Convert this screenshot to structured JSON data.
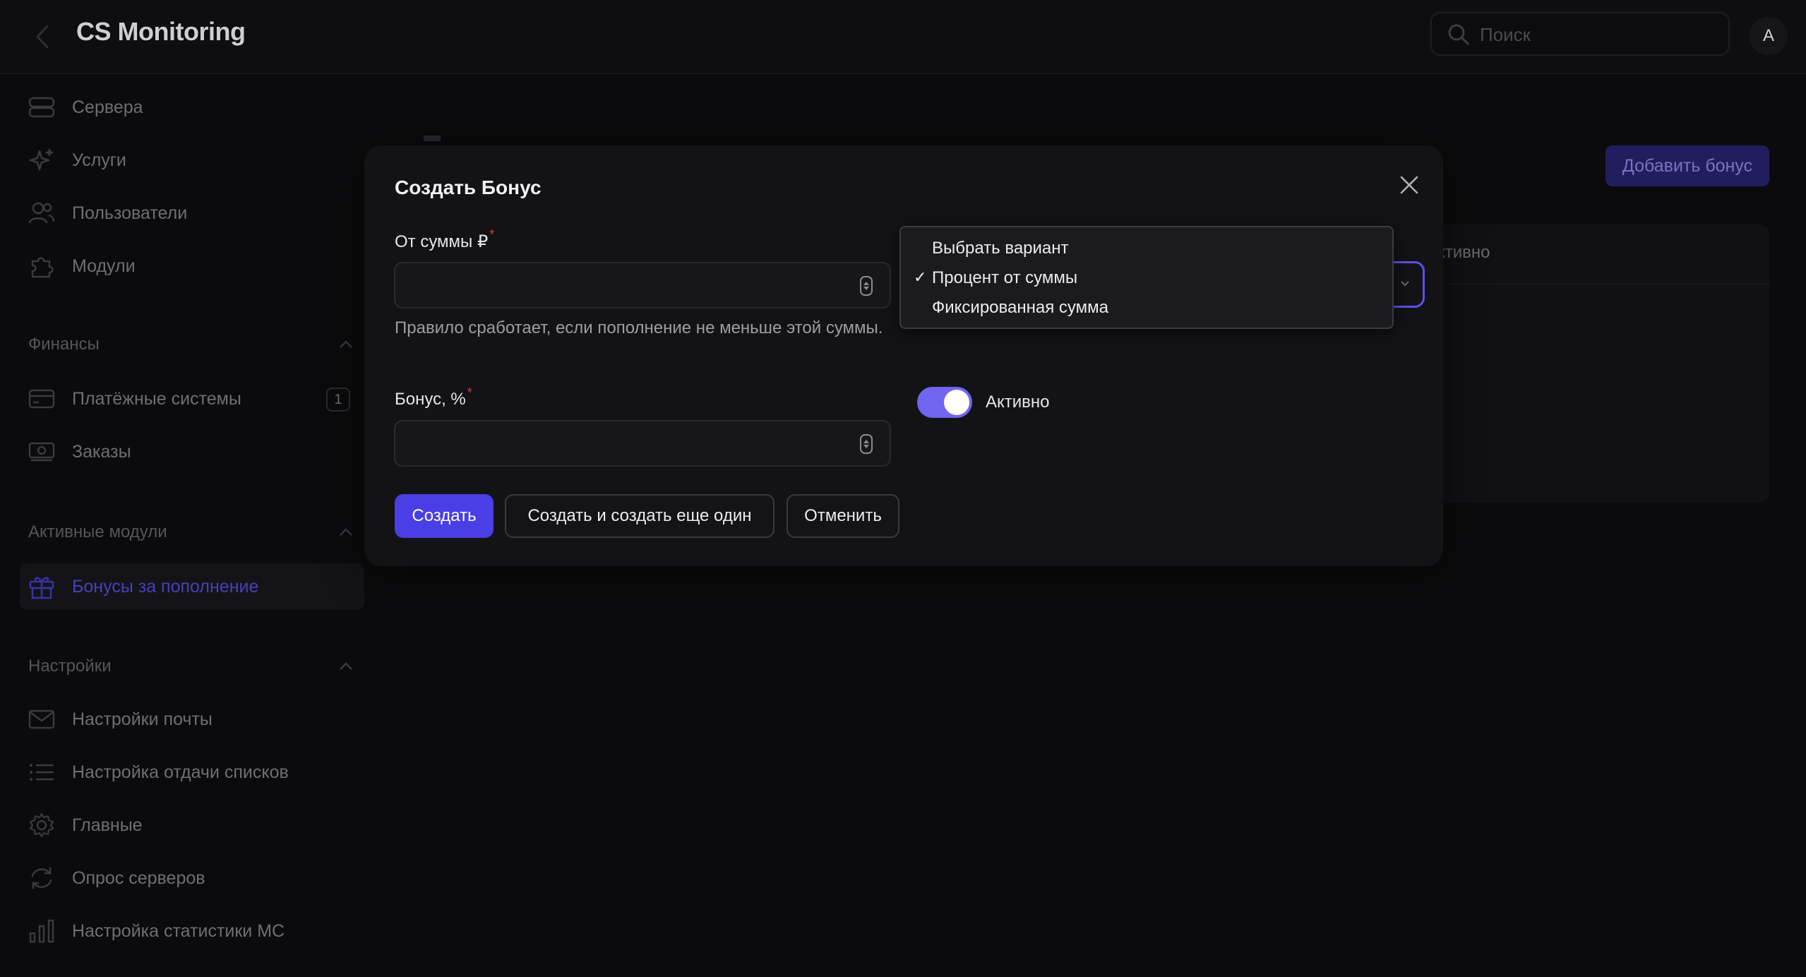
{
  "app": {
    "title": "CS Monitoring"
  },
  "search": {
    "placeholder": "Поиск"
  },
  "user": {
    "avatar_initial": "A"
  },
  "sidebar": {
    "items": [
      {
        "label": "Сервера",
        "icon": "server-icon"
      },
      {
        "label": "Услуги",
        "icon": "sparkles-icon"
      },
      {
        "label": "Пользователи",
        "icon": "users-icon"
      },
      {
        "label": "Модули",
        "icon": "puzzle-icon"
      }
    ],
    "finance": {
      "title": "Финансы",
      "items": [
        {
          "label": "Платёжные системы",
          "icon": "credit-card-icon",
          "badge": "1"
        },
        {
          "label": "Заказы",
          "icon": "cash-icon"
        }
      ]
    },
    "active_modules": {
      "title": "Активные модули",
      "items": [
        {
          "label": "Бонусы за пополнение",
          "icon": "gift-icon"
        }
      ]
    },
    "settings": {
      "title": "Настройки",
      "items": [
        {
          "label": "Настройки почты",
          "icon": "envelope-icon"
        },
        {
          "label": "Настройка отдачи списков",
          "icon": "list-icon"
        },
        {
          "label": "Главные",
          "icon": "gear-icon"
        },
        {
          "label": "Опрос серверов",
          "icon": "refresh-icon"
        },
        {
          "label": "Настройка статистики МС",
          "icon": "bar-chart-icon"
        }
      ]
    }
  },
  "main": {
    "add_bonus_label": "Добавить бонус",
    "table_col_fragment": "ктивно"
  },
  "modal": {
    "title": "Создать Бонус",
    "from_sum": {
      "label": "От суммы ₽",
      "required": "*",
      "value": "",
      "hint": "Правило сработает, если пополнение не меньше этой суммы."
    },
    "bonus": {
      "label": "Бонус, %",
      "required": "*",
      "value": ""
    },
    "type_select": {
      "options": [
        "Выбрать вариант",
        "Процент от суммы",
        "Фиксированная сумма"
      ],
      "selected": "Процент от суммы",
      "check": "✓"
    },
    "active_toggle": {
      "label": "Активно",
      "on": true
    },
    "buttons": {
      "create": "Создать",
      "create_another": "Создать и создать еще один",
      "cancel": "Отменить"
    }
  },
  "colors": {
    "accent": "#4a3ee6",
    "toggle": "#7065f0",
    "background": "#0b0b0d",
    "modal": "#131316",
    "required": "#d43a3a"
  }
}
